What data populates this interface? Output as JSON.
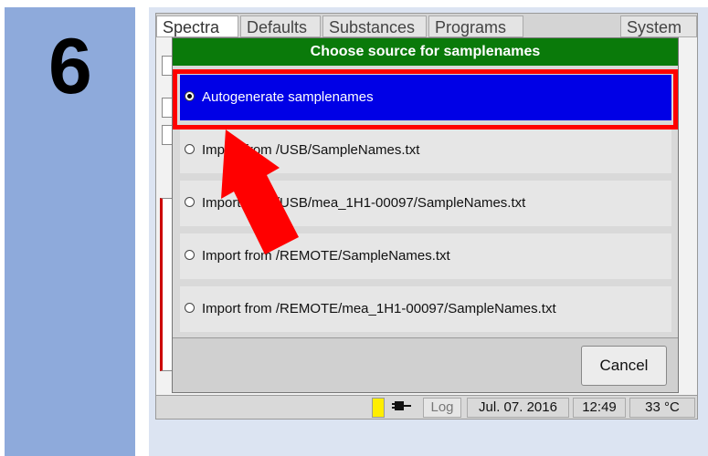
{
  "step": {
    "number": "6",
    "color": "#8eaadb"
  },
  "tabs": [
    {
      "label": "Spectra",
      "active": true
    },
    {
      "label": "Defaults",
      "active": false
    },
    {
      "label": "Substances",
      "active": false
    },
    {
      "label": "Programs",
      "active": false
    },
    {
      "label": "System",
      "active": false
    }
  ],
  "dialog": {
    "title": "Choose source for samplenames",
    "header_color": "#0a7a0a",
    "options": [
      {
        "label": "Autogenerate samplenames",
        "selected": true
      },
      {
        "label": "Import from /USB/SampleNames.txt",
        "selected": false
      },
      {
        "label": "Import from /USB/mea_1H1-00097/SampleNames.txt",
        "selected": false
      },
      {
        "label": "Import from /REMOTE/SampleNames.txt",
        "selected": false
      },
      {
        "label": "Import from /REMOTE/mea_1H1-00097/SampleNames.txt",
        "selected": false
      }
    ],
    "cancel_label": "Cancel",
    "selection_color": "#0000e6"
  },
  "statusbar": {
    "log_label": "Log",
    "date": "Jul. 07. 2016",
    "time": "12:49",
    "temperature": "33 °C"
  },
  "annotation": {
    "arrow_color": "#ff0000",
    "icon": "red-arrow-icon"
  }
}
